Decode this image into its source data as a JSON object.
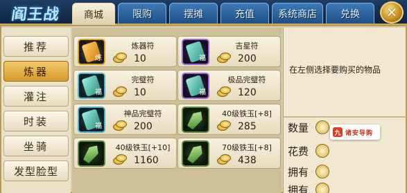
{
  "header": {
    "logo": "阎王战",
    "tabs": [
      {
        "label": "商城",
        "active": true
      },
      {
        "label": "限购",
        "active": false
      },
      {
        "label": "摆摊",
        "active": false
      },
      {
        "label": "充值",
        "active": false
      },
      {
        "label": "系统商店",
        "active": false
      },
      {
        "label": "兑换",
        "active": false
      }
    ],
    "close_label": "✕"
  },
  "categories": [
    {
      "label": "推荐",
      "active": false
    },
    {
      "label": "炼器",
      "active": true
    },
    {
      "label": "灌注",
      "active": false
    },
    {
      "label": "时装",
      "active": false
    },
    {
      "label": "坐骑",
      "active": false
    },
    {
      "label": "发型脸型",
      "active": false
    }
  ],
  "items": [
    {
      "name": "炼器符",
      "price": "10",
      "icon": "forge-charm-icon",
      "frame": "orange",
      "glyph": "炼"
    },
    {
      "name": "吉星符",
      "price": "200",
      "icon": "lucky-star-charm-icon",
      "frame": "purple",
      "glyph": "福"
    },
    {
      "name": "完璧符",
      "price": "10",
      "icon": "flawless-charm-icon",
      "frame": "teal",
      "glyph": "福"
    },
    {
      "name": "极品完璧符",
      "price": "120",
      "icon": "premium-flawless-charm-icon",
      "frame": "purple",
      "glyph": "福"
    },
    {
      "name": "神品完璧符",
      "price": "200",
      "icon": "divine-flawless-charm-icon",
      "frame": "teal",
      "glyph": "福"
    },
    {
      "name": "40级铁玉[+8]",
      "price": "285",
      "icon": "iron-jade-icon",
      "frame": "green",
      "glyph": ""
    },
    {
      "name": "40级铁玉[+10]",
      "price": "1160",
      "icon": "iron-jade-icon",
      "frame": "green",
      "glyph": ""
    },
    {
      "name": "70级铁玉[+8]",
      "price": "438",
      "icon": "iron-jade-icon",
      "frame": "green",
      "glyph": ""
    }
  ],
  "detail": {
    "hint": "在左侧选择要购买的物品",
    "rows": [
      "数量",
      "花费",
      "拥有",
      "拥有"
    ]
  },
  "watermark": {
    "badge": "九",
    "text": "诸安导购"
  },
  "colors": {
    "accent_gold": "#d59a2c",
    "tab_blue": "#1d4f86",
    "panel_cream": "#f0e8d0"
  }
}
